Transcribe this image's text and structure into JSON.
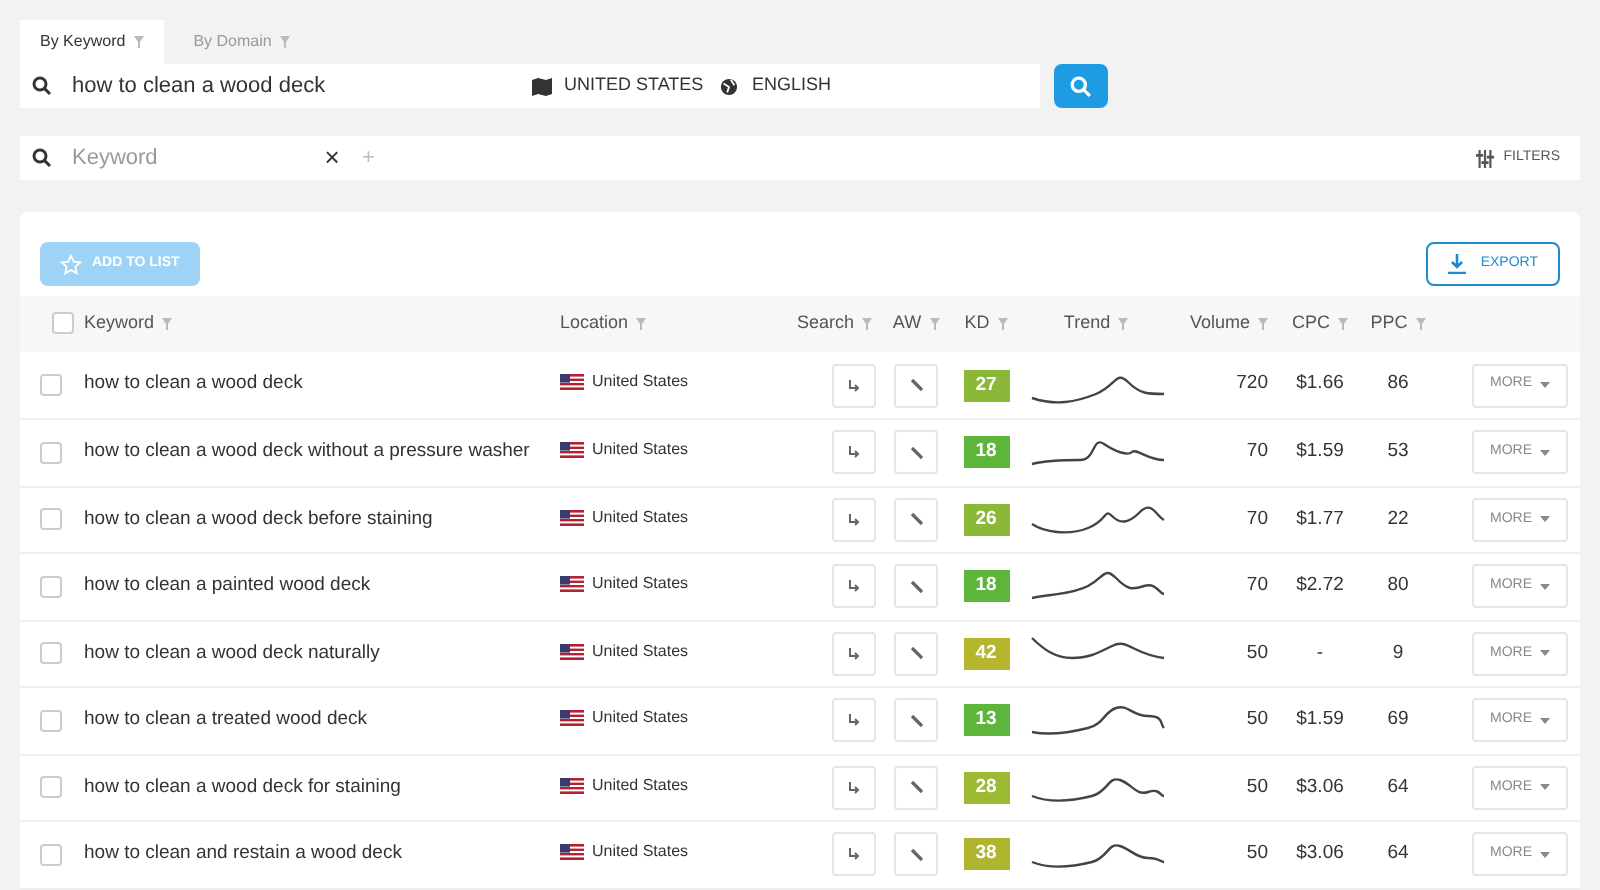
{
  "tabs": [
    {
      "label": "By Keyword",
      "selected": true
    },
    {
      "label": "By Domain",
      "selected": false
    }
  ],
  "search": {
    "value": "how to clean a wood deck",
    "location": "UNITED STATES",
    "language": "ENGLISH"
  },
  "filter": {
    "placeholder": "Keyword",
    "clear": "×",
    "add": "+",
    "filters_label": "FILTERS"
  },
  "toolbar": {
    "add_to_list": "ADD TO LIST",
    "add_disabled": true,
    "export": "EXPORT"
  },
  "table": {
    "select_all_checked": false,
    "columns": [
      "Keyword",
      "Location",
      "Search",
      "AW",
      "KD",
      "Trend",
      "Volume",
      "CPC",
      "PPC"
    ],
    "rows": [
      {
        "keyword": "how to clean a wood deck",
        "location": "United States",
        "kd": "27",
        "color": "#8cb83a",
        "volume": "720",
        "cpc": "$1.66",
        "ppc": "86",
        "more": "MORE",
        "checked": false
      },
      {
        "keyword": "how to clean a wood deck without a pressure washer",
        "location": "United States",
        "kd": "18",
        "color": "#5db53c",
        "volume": "70",
        "cpc": "$1.59",
        "ppc": "53",
        "more": "MORE",
        "checked": false
      },
      {
        "keyword": "how to clean a wood deck before staining",
        "location": "United States",
        "kd": "26",
        "color": "#8cb83a",
        "volume": "70",
        "cpc": "$1.77",
        "ppc": "22",
        "more": "MORE",
        "checked": false
      },
      {
        "keyword": "how to clean a painted wood deck",
        "location": "United States",
        "kd": "18",
        "color": "#5db53c",
        "volume": "70",
        "cpc": "$2.72",
        "ppc": "80",
        "more": "MORE",
        "checked": false
      },
      {
        "keyword": "how to clean a wood deck naturally",
        "location": "United States",
        "kd": "42",
        "color": "#b5b52e",
        "volume": "50",
        "cpc": "-",
        "ppc": "9",
        "more": "MORE",
        "checked": false
      },
      {
        "keyword": "how to clean a treated wood deck",
        "location": "United States",
        "kd": "13",
        "color": "#5db53c",
        "volume": "50",
        "cpc": "$1.59",
        "ppc": "69",
        "more": "MORE",
        "checked": false
      },
      {
        "keyword": "how to clean a wood deck for staining",
        "location": "United States",
        "kd": "28",
        "color": "#9cba34",
        "volume": "50",
        "cpc": "$3.06",
        "ppc": "64",
        "more": "MORE",
        "checked": false
      },
      {
        "keyword": "how to clean and restain a wood deck",
        "location": "United States",
        "kd": "38",
        "color": "#b0b530",
        "volume": "50",
        "cpc": "$3.06",
        "ppc": "64",
        "more": "MORE",
        "checked": false
      }
    ]
  }
}
